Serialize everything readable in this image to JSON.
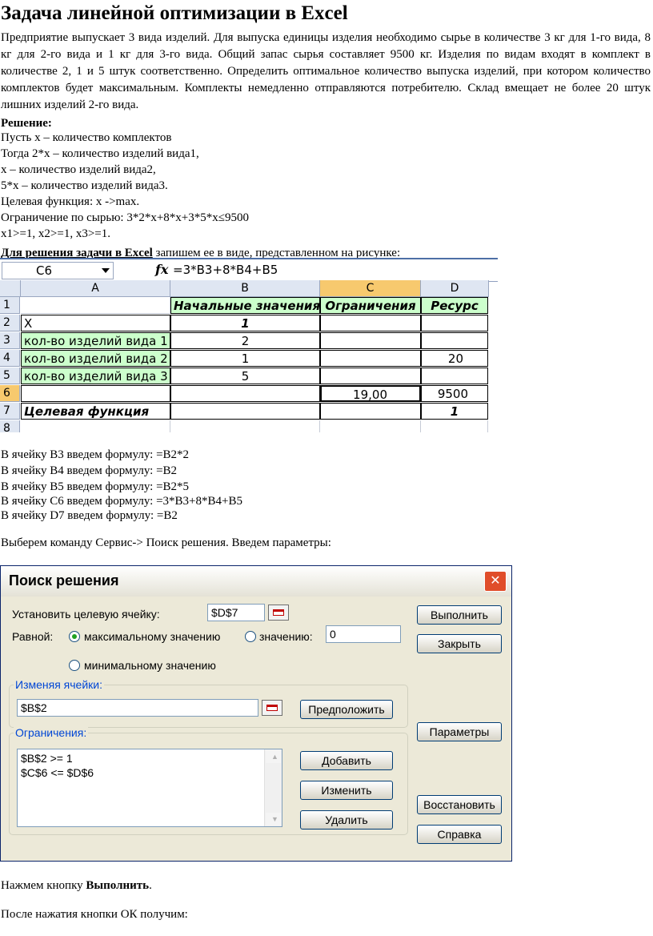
{
  "title": "Задача линейной оптимизации в Excel",
  "problem": "Предприятие выпускает 3 вида изделий. Для выпуска единицы изделия необходимо сырье в количестве 3 кг для 1-го вида, 8 кг для 2-го вида и 1 кг для 3-го вида. Общий запас сырья составляет 9500 кг. Изделия по видам входят в комплект в количестве 2, 1 и 5 штук соответственно. Определить оптимальное количество выпуска изделий, при котором количество комплектов будет максимальным. Комплекты немедленно отправляются потребителю. Склад вмещает не более 20 штук лишних изделий 2-го вида.",
  "solution_heading": "Решение:",
  "solution_lines": [
    "Пусть х – количество комплектов",
    "Тогда 2*х – количество изделий вида1,",
    "х – количество изделий вида2,",
    "5*х – количество изделий вида3.",
    "Целевая функция: х ->max.",
    "Ограничение по сырью: 3*2*х+8*х+3*5*х≤9500",
    "x1>=1, x2>=1, x3>=1."
  ],
  "excel_intro_bold": "Для решения задачи в Excel",
  "excel_intro_rest": " запишем ее в виде, представленном на рисунке:",
  "excel": {
    "name_box": "C6",
    "fx": "fx",
    "formula": "=3*B3+8*B4+B5",
    "columns": [
      "A",
      "B",
      "C",
      "D"
    ],
    "rows": [
      "1",
      "2",
      "3",
      "4",
      "5",
      "6",
      "7",
      "8"
    ],
    "headers": {
      "b1": "Начальные значения",
      "c1": "Ограничения",
      "d1": "Ресурс"
    },
    "a2": "X",
    "b2": "1",
    "a3": "кол-во изделий вида 1",
    "b3": "2",
    "a4": "кол-во изделий вида 2",
    "b4": "1",
    "d4": "20",
    "a5": "кол-во изделий вида 3",
    "b5": "5",
    "c6": "19,00",
    "d6": "9500",
    "a7": "Целевая функция",
    "d7": "1"
  },
  "formula_lines": [
    "В ячейку B3 введем формулу: =B2*2",
    "В ячейку B4 введем формулу: =B2",
    "В ячейку B5 введем формулу: =B2*5",
    "В ячейку C6 введем формулу: =3*B3+8*B4+B5",
    "В ячейку D7 введем формулу: =B2"
  ],
  "solver_intro": "Выберем команду Сервис-> Поиск решения. Введем параметры:",
  "solver": {
    "title": "Поиск решения",
    "close_glyph": "✕",
    "target_label": "Установить целевую ячейку:",
    "target_value": "$D$7",
    "equal_label": "Равной:",
    "opt_max": "максимальному значению",
    "opt_value": "значению:",
    "value_field": "0",
    "opt_min": "минимальному значению",
    "changing_label": "Изменяя ячейки:",
    "changing_value": "$B$2",
    "guess_button": "Предположить",
    "constraints_label": "Ограничения:",
    "constraints": [
      "$B$2 >= 1",
      "$C$6 <= $D$6"
    ],
    "add_button": "Добавить",
    "change_button": "Изменить",
    "delete_button": "Удалить",
    "run_button": "Выполнить",
    "close_button": "Закрыть",
    "options_button": "Параметры",
    "restore_button": "Восстановить",
    "help_button": "Справка"
  },
  "press_prefix": "Нажмем кнопку ",
  "press_bold": "Выполнить",
  "press_suffix": ".",
  "after_ok": "После нажатия кнопки ОК получим:"
}
